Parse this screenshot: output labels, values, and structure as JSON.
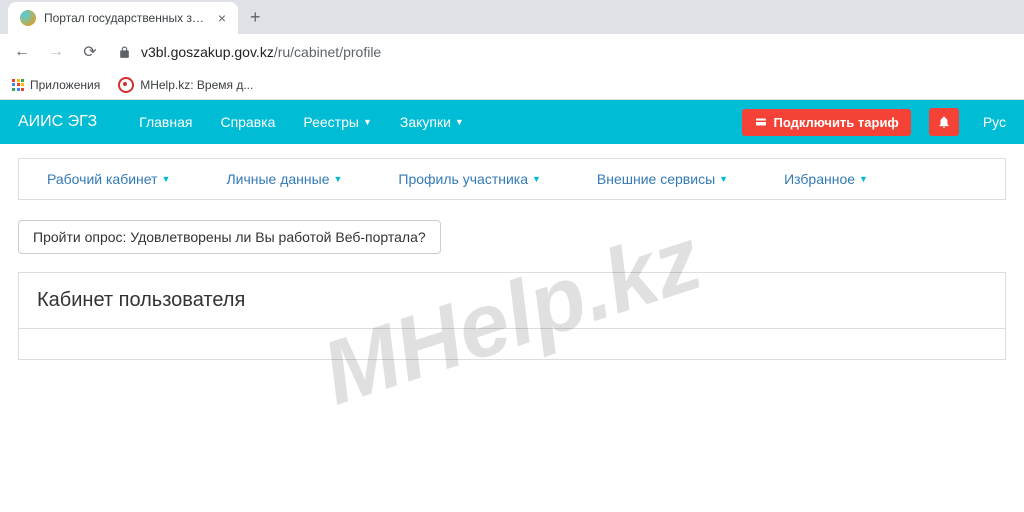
{
  "browser": {
    "tab_title": "Портал государственных закупо",
    "url_domain": "v3bl.goszakup.gov.kz",
    "url_path": "/ru/cabinet/profile",
    "bookmarks": {
      "apps": "Приложения",
      "mhelp": "MHelp.kz: Время д..."
    }
  },
  "topnav": {
    "brand": "АИИС ЭГЗ",
    "items": [
      "Главная",
      "Справка",
      "Реестры",
      "Закупки"
    ],
    "tariff_btn": "Подключить тариф",
    "lang": "Рус"
  },
  "subnav": [
    "Рабочий кабинет",
    "Личные данные",
    "Профиль участника",
    "Внешние сервисы",
    "Избранное"
  ],
  "survey": "Пройти опрос: Удовлетворены ли Вы работой Веб-портала?",
  "panel_title": "Кабинет пользователя",
  "watermark": "MHelp.kz"
}
